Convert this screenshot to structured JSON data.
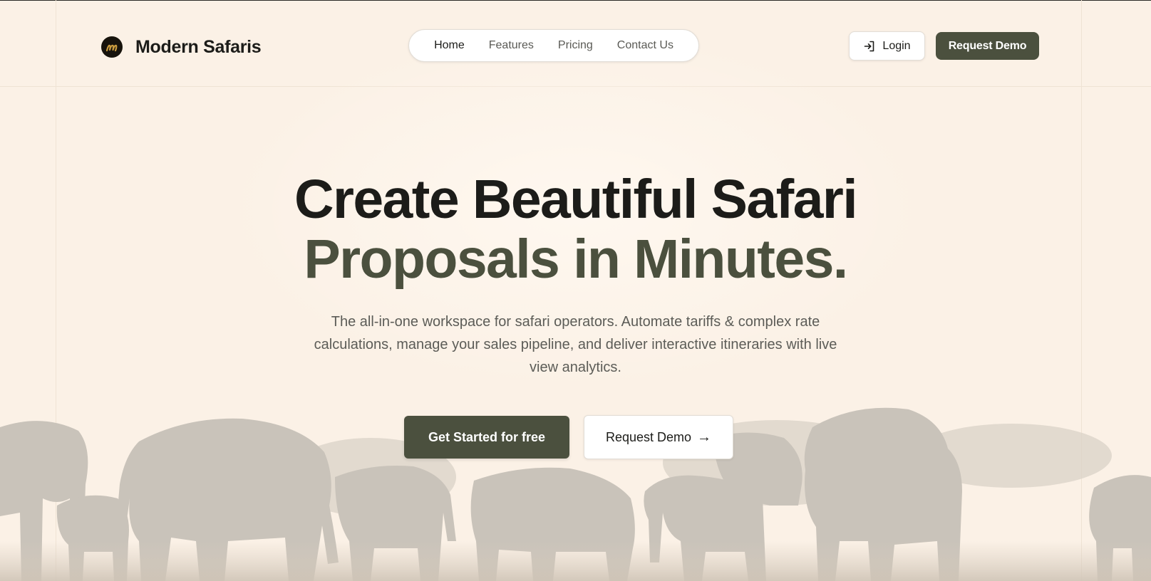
{
  "header": {
    "logo_text": "Modern Safaris",
    "nav": [
      {
        "label": "Home",
        "active": true
      },
      {
        "label": "Features"
      },
      {
        "label": "Pricing"
      },
      {
        "label": "Contact Us"
      }
    ],
    "login_label": "Login",
    "request_demo_label": "Request Demo"
  },
  "hero": {
    "title_line1": "Create Beautiful Safari",
    "title_line2": "Proposals in Minutes.",
    "subtitle": "The all-in-one workspace for safari operators. Automate tariffs & complex rate calculations, manage your sales pipeline, and deliver interactive itineraries with live view analytics.",
    "cta_primary": "Get Started for free",
    "cta_secondary": "Request Demo",
    "cta_secondary_arrow": "→"
  },
  "icons": {
    "logo": "logo-mark-icon",
    "login": "login-icon",
    "arrow": "arrow-right-icon"
  },
  "colors": {
    "background": "#fbf1e6",
    "brand_dark": "#4b503e",
    "text": "#1c1c19",
    "muted_text": "#5c5c57"
  }
}
